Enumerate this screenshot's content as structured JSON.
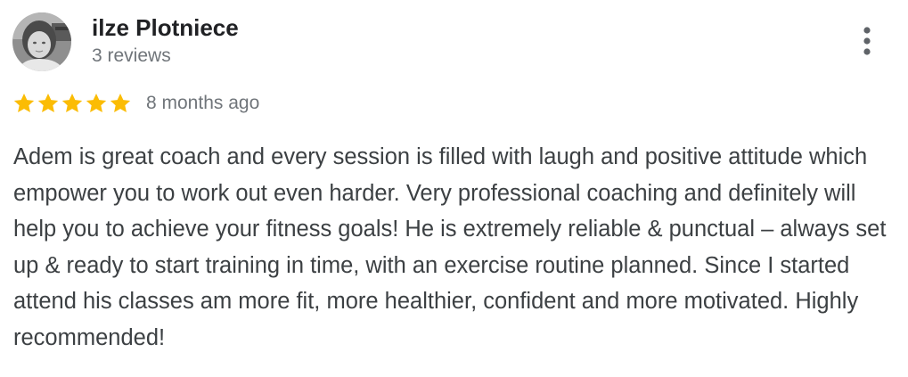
{
  "review": {
    "author_name": "ilze Plotniece",
    "author_reviews": "3 reviews",
    "rating_stars": 5,
    "rating_max": 5,
    "date": "8 months ago",
    "text": "Adem is great coach and every session is filled with laugh and positive attitude which empower you to work out even harder. Very professional coaching and definitely will help you to achieve your fitness goals! He is extremely reliable & punctual – always set up & ready to start training in time, with an exercise routine planned. Since I started attend his classes am more fit, more healthier, confident and more motivated. Highly recommended!"
  },
  "icons": {
    "star": "star-icon",
    "more": "more-vertical-icon",
    "avatar": "avatar"
  },
  "colors": {
    "star": "#fbbc04",
    "name_text": "#202124",
    "secondary_text": "#70757a",
    "body_text": "#3c4043",
    "more_icon": "#5f6368"
  }
}
